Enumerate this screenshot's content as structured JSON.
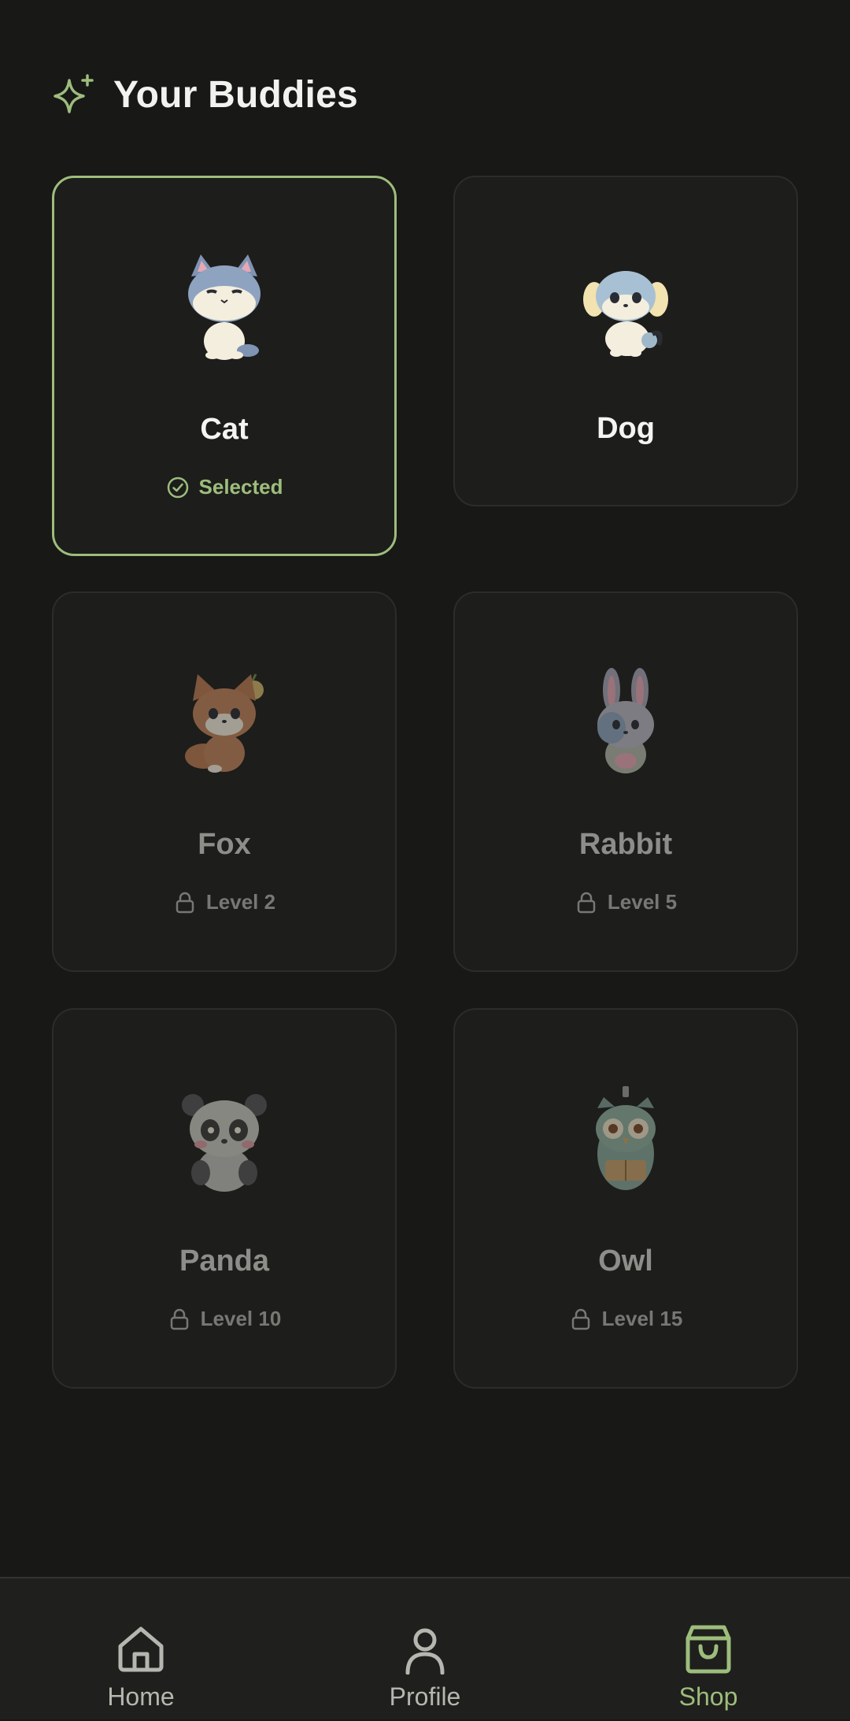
{
  "header": {
    "title": "Your Buddies",
    "icon": "sparkle-icon"
  },
  "colors": {
    "accent": "#9dbd7c",
    "background": "#181817",
    "card": "#1d1d1b"
  },
  "buddies": [
    {
      "name": "Cat",
      "status": "Selected",
      "state": "selected"
    },
    {
      "name": "Dog",
      "status": "",
      "state": "unlocked"
    },
    {
      "name": "Fox",
      "status": "Level 2",
      "state": "locked"
    },
    {
      "name": "Rabbit",
      "status": "Level 5",
      "state": "locked"
    },
    {
      "name": "Panda",
      "status": "Level 10",
      "state": "locked"
    },
    {
      "name": "Owl",
      "status": "Level 15",
      "state": "locked"
    }
  ],
  "nav": {
    "items": [
      {
        "label": "Home",
        "icon": "home-icon"
      },
      {
        "label": "Profile",
        "icon": "profile-icon"
      },
      {
        "label": "Shop",
        "icon": "shopping-bag-icon",
        "active": true
      }
    ]
  }
}
